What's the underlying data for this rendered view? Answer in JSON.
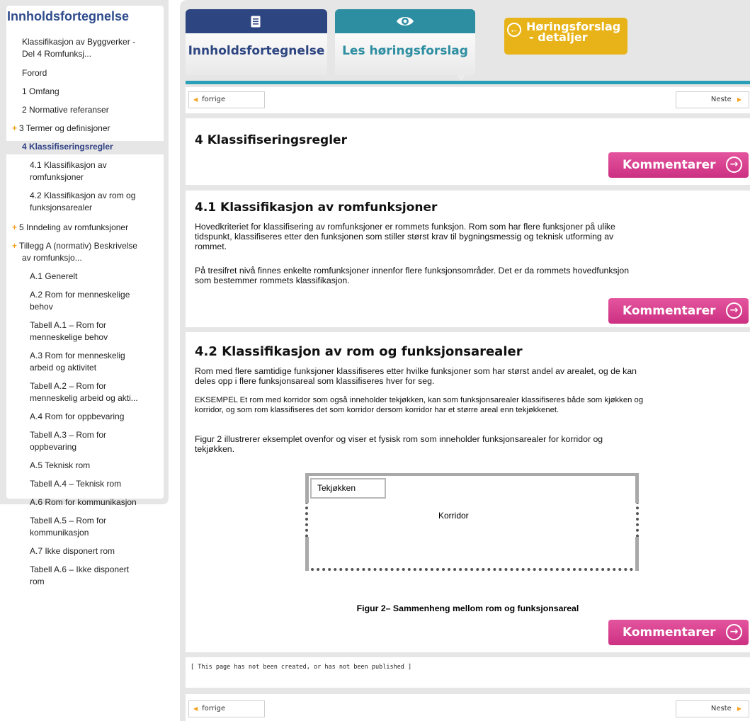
{
  "sidebar": {
    "title": "Innholdsfortegnelse",
    "items": [
      {
        "label": "Klassifikasjon av Byggverker -",
        "expandable": false
      },
      {
        "label": "Del 4 Romfunksj...",
        "expandable": false
      },
      {
        "label": "Forord",
        "expandable": false
      },
      {
        "label": "1 Omfang",
        "expandable": false
      },
      {
        "label": "2 Normative referanser",
        "expandable": false
      },
      {
        "label": "3 Termer og definisjoner",
        "expandable": true
      },
      {
        "label": "4 Klassifiseringsregler",
        "expandable": false
      },
      {
        "label": "4.1 Klassifikasjon av",
        "expandable": false
      },
      {
        "label": "romfunksjoner",
        "expandable": false
      },
      {
        "label": "4.2 Klassifikasjon av rom og",
        "expandable": false
      },
      {
        "label": "funksjonsarealer",
        "expandable": false
      },
      {
        "label": "5 Inndeling av romfunksjoner",
        "expandable": true
      },
      {
        "label": "Tillegg A (normativ) Beskrivelse",
        "expandable": true
      },
      {
        "label": "av romfunksjo...",
        "expandable": false
      },
      {
        "label": "A.1 Generelt",
        "expandable": false
      },
      {
        "label": "A.2 Rom for menneskelige",
        "expandable": false
      },
      {
        "label": "behov",
        "expandable": false
      },
      {
        "label": "Tabell A.1 – Rom for",
        "expandable": false
      },
      {
        "label": "menneskelige behov",
        "expandable": false
      },
      {
        "label": "A.3 Rom for menneskelig",
        "expandable": false
      },
      {
        "label": "arbeid og aktivitet",
        "expandable": false
      },
      {
        "label": "Tabell A.2 – Rom for",
        "expandable": false
      },
      {
        "label": "menneskelig arbeid og akti...",
        "expandable": false
      },
      {
        "label": "A.4 Rom for oppbevaring",
        "expandable": false
      },
      {
        "label": "Tabell A.3 – Rom for",
        "expandable": false
      },
      {
        "label": "oppbevaring",
        "expandable": false
      },
      {
        "label": "A.5 Teknisk rom",
        "expandable": false
      },
      {
        "label": "Tabell A.4 – Teknisk rom",
        "expandable": false
      },
      {
        "label": "A.6 Rom for kommunikasjon",
        "expandable": false
      },
      {
        "label": "Tabell A.5 – Rom for",
        "expandable": false
      },
      {
        "label": "kommunikasjon",
        "expandable": false
      },
      {
        "label": "A.7 Ikke disponert rom",
        "expandable": false
      },
      {
        "label": "Tabell A.6 – Ikke disponert",
        "expandable": false
      },
      {
        "label": "rom",
        "expandable": false
      }
    ]
  },
  "tabs": {
    "toc_label": "Innholdsfortegnelse",
    "toc_icon": "document-icon",
    "read_label": "Les høringsforslag",
    "read_icon": "eye-icon",
    "hearing_line1": "Høringsforslag",
    "hearing_line2": "- detaljer",
    "hearing_icon": "circle-arrow-left-icon"
  },
  "nav": {
    "prev_label": "forrige",
    "next_label": "Neste"
  },
  "sections": {
    "s4": {
      "title": "4 Klassifiseringsregler"
    },
    "s41": {
      "title": "4.1 Klassifikasjon av romfunksjoner",
      "p1_line1": "Hovedkriteriet for klassifisering av romfunksjoner er rommets funksjon. Rom som har flere funksjoner på ulike",
      "p1_line2": "tidspunkt, klassifiseres etter den funksjonen som stiller størst krav til bygningsmessig og teknisk utforming av",
      "p1_line3": "rommet.",
      "p2_line1": "På tresifret nivå finnes enkelte romfunksjoner innenfor flere funksjonsområder. Det er da rommets hovedfunksjon",
      "p2_line2": "som bestemmer rommets klassifikasjon."
    },
    "s42": {
      "title": "4.2 Klassifikasjon av rom og funksjonsarealer",
      "p1_line1": "Rom med flere samtidige funksjoner klassifiseres etter hvilke funksjoner som har størst andel av arealet, og de kan",
      "p1_line2": "deles opp i flere funksjonsareal som klassifiseres hver for seg.",
      "p2_line1": "EKSEMPEL Et rom med korridor som også inneholder tekjøkken, kan som funksjonsarealer klassifiseres både som kjøkken og",
      "p2_line2": "korridor, og som rom klassifiseres det som korridor dersom korridor har et større areal enn tekjøkkenet.",
      "p3_line1": "Figur 2 illustrerer eksemplet ovenfor og viser et fysisk rom som inneholder funksjonsarealer for korridor og",
      "p3_line2": "tekjøkken.",
      "figure_kitchen": "Tekjøkken",
      "figure_corridor": "Korridor",
      "figure_caption": "Figur 2– Sammenheng mellom rom og funksjonsareal"
    }
  },
  "comment_label": "Kommentarer",
  "not_created_text": "[ This page has not been created, or has not been published ]",
  "colors": {
    "toc_tab": "#2d4580",
    "read_tab": "#2e8ea1",
    "hearing_tab": "#e8b318",
    "accent_line": "#2aa0b8",
    "comment_button": "#d83a8c",
    "arrow_orange": "#f4a21e"
  }
}
